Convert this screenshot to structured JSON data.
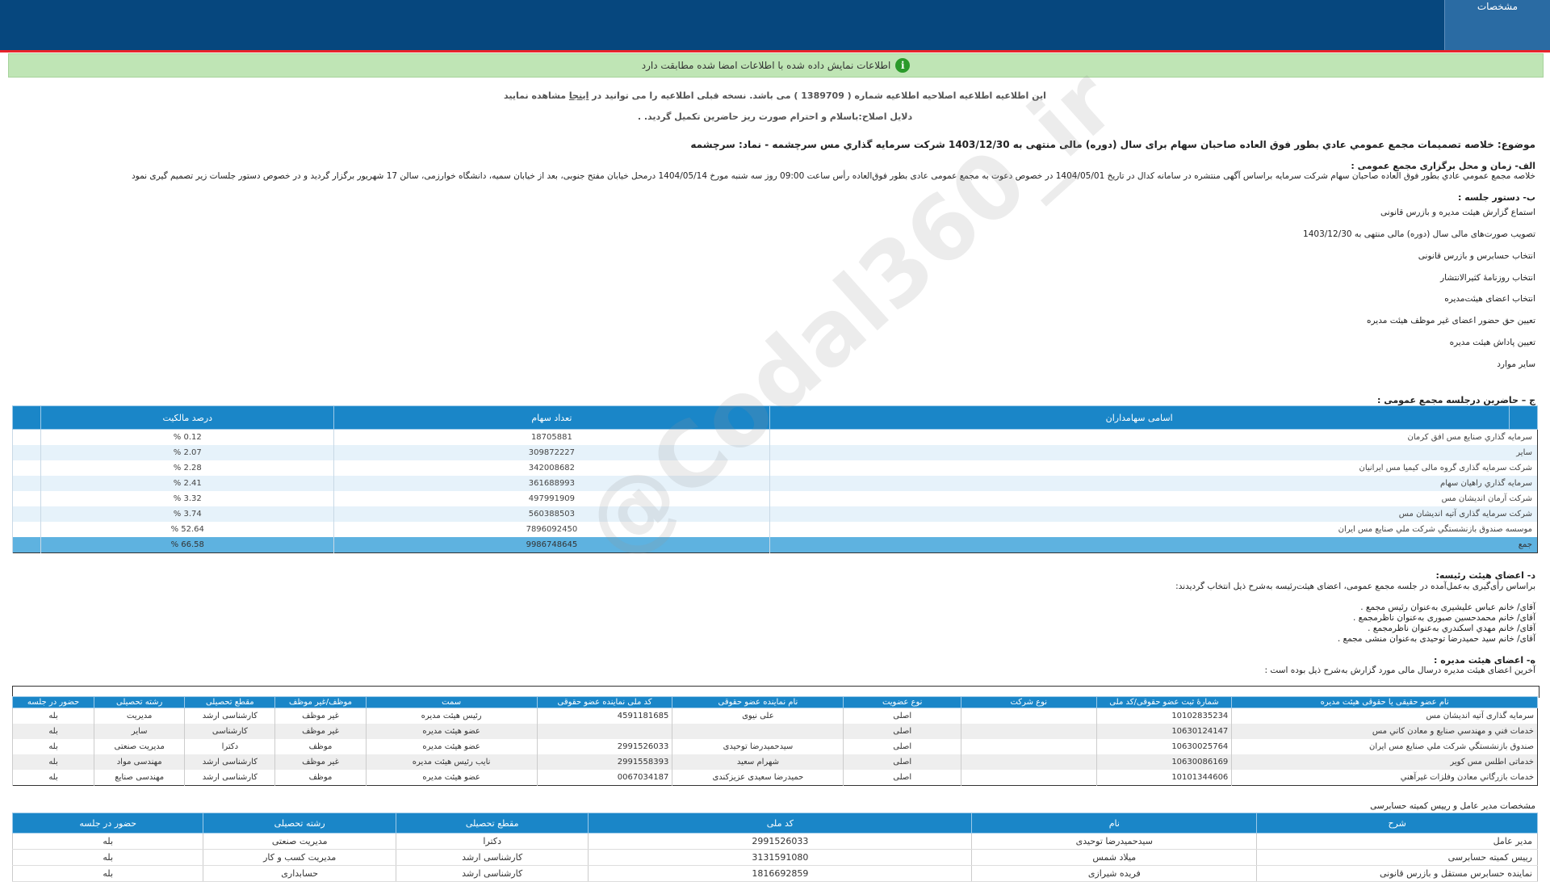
{
  "header": {
    "tab_label": "مشخصات"
  },
  "notice": {
    "text": "اطلاعات نمایش داده شده با اطلاعات امضا شده مطابقت دارد"
  },
  "correction": {
    "line1_prefix": "این اطلاعیه اطلاعیه اصلاحیه اطلاعیه شماره ( 1389709 ) می باشد. نسخه قبلی اطلاعیه را می توانید در ",
    "link": "اینجا",
    "line1_suffix": " مشاهده نمایید",
    "line2": "دلایل اصلاح:باسلام و احترام صورت ریز حاضرین تکمیل گردید. ."
  },
  "subject": "موضوع: خلاصه تصمیمات مجمع عمومي عادي بطور فوق العاده صاحبان سهام برای سال (دوره) مالی منتهی به 1403/12/30 شركت سرمايه گذاري مس سرچشمه - نماد: سرچشمه",
  "section_a": {
    "title": "الف- زمان و محل برگزاری مجمع عمومی :",
    "text": "خلاصه مجمع عمومي عادي بطور فوق العاده صاحبان سهام شرکت سرمایه براساس آگهی منتشره در سامانه کدال در تاریخ 1404/05/01 در خصوص دعوت به مجمع عمومی عادی بطور فوق‌العاده رأس ساعت 09:00 روز سه شنبه مورخ 1404/05/14 درمحل  خیابان مفتح جنوبی، بعد از خیابان سمیه، دانشگاه خوارزمی، سالن 17 شهریور   برگزار گردید و در خصوص دستور جلسات زیر تصمیم گیری نمود"
  },
  "section_b": {
    "title": "ب- دستور جلسه :",
    "items": [
      "استماع گزارش هیئت مدیره و بازرس قانونی",
      "تصویب صورت‌های مالی سال (دوره) مالی منتهی به 1403/12/30",
      "انتخاب حسابرس و بازرس قانونی",
      "انتخاب روزنامهٔ کثیرالانتشار",
      "انتخاب اعضای هیئت‌مدیره",
      "تعیین حق حضور اعضای غیر موظف هیئت مدیره",
      "تعیین پاداش هیئت مدیره",
      "سایر موارد"
    ]
  },
  "section_c": {
    "title": "ج – حاضرین درجلسه مجمع عمومی :",
    "headers": [
      "اسامی سهامداران",
      "تعداد سهام",
      "درصد مالکیت"
    ],
    "rows": [
      [
        "سرمايه گذاري صنايع مس افق كرمان",
        "18705881",
        "0.12 %"
      ],
      [
        "سایر",
        "309872227",
        "2.07 %"
      ],
      [
        "شرکت سرمایه گذاری گروه مالی کیمیا مس ایرانیان",
        "342008682",
        "2.28 %"
      ],
      [
        "سرمايه گذاري راهيان سهام",
        "361688993",
        "2.41 %"
      ],
      [
        "شرکت آرمان اندیشان مس",
        "497991909",
        "3.32 %"
      ],
      [
        "شرکت سرمایه گذاری آتیه اندیشان مس",
        "560388503",
        "3.74 %"
      ],
      [
        "موسسه صندوق بازنشستگي شركت ملي صنايع مس ايران",
        "7896092450",
        "52.64 %"
      ]
    ],
    "total": [
      "جمع",
      "9986748645",
      "66.58 %"
    ]
  },
  "section_d": {
    "title": "د- اعضای هیئت رئیسه:",
    "text": "براساس رأی‌گیری به‌عمل‌آمده در جلسه مجمع عمومی، اعضای هیئت‌رئیسه به‌شرح ذیل انتخاب گردیدند:",
    "members": [
      "آقای/ خانم  عباس علیشیری  به‌عنوان رئیس مجمع .",
      "آقای/ خانم  محمدحسین صبوری  به‌عنوان ناظرمجمع .",
      "آقای/ خانم  مهدي اسكندري  به‌عنوان ناظرمجمع .",
      "آقای/ خانم  سید حمیدرضا توحیدی  به‌عنوان منشی مجمع ."
    ]
  },
  "section_e": {
    "title": "ه- اعضای هیئت مدیره :",
    "text": "آخرین اعضای هیئت مدیره درسال مالی مورد گزارش به‌شرح ذیل بوده است :",
    "headers": [
      "نام عضو حقیقی یا حقوقی هیئت مدیره",
      "شمارهٔ ثبت عضو حقوقی/کد ملی",
      "نوع شرکت",
      "نوع عضویت",
      "نام نماینده عضو حقوقی",
      "کد ملی نماینده عضو حقوقی",
      "سمت",
      "موظف/غیر موظف",
      "مقطع تحصیلی",
      "رشته تحصیلی",
      "حضور در جلسه"
    ],
    "rows": [
      [
        "سرمایه گذاری آتیه اندیشان مس",
        "10102835234",
        "",
        "اصلی",
        "علی نیوی",
        "4591181685",
        "رئیس هیئت مدیره",
        "غیر موظف",
        "کارشناسی ارشد",
        "مدیریت",
        "بله"
      ],
      [
        "خدمات فني و مهندسي صنايع و معادن كاني مس",
        "10630124147",
        "",
        "اصلی",
        "",
        "",
        "عضو هیئت مدیره",
        "غیر موظف",
        "کارشناسی",
        "سایر",
        "بله"
      ],
      [
        "صندوق بازنشستگي شركت ملي صنايع مس ايران",
        "10630025764",
        "",
        "اصلی",
        "سیدحمیدرضا توحیدی",
        "2991526033",
        "عضو هیئت مدیره",
        "موظف",
        "دکترا",
        "مدیریت صنعتی",
        "بله"
      ],
      [
        "خدماتی اطلس مس کویر",
        "10630086169",
        "",
        "اصلی",
        "شهرام سعید",
        "2991558393",
        "نایب رئیس هیئت مدیره",
        "غیر موظف",
        "کارشناسی ارشد",
        "مهندسی مواد",
        "بله"
      ],
      [
        "خدمات بازرگاني معادن وفلزات غيرآهني",
        "10101344606",
        "",
        "اصلی",
        "حمیدرضا سعیدی عزیزکندی",
        "0067034187",
        "عضو هیئت مدیره",
        "موظف",
        "کارشناسی ارشد",
        "مهندسی صنایع",
        "بله"
      ]
    ]
  },
  "section_f": {
    "title": "مشخصات مدیر عامل و رییس کمیته حسابرسی",
    "headers": [
      "شرح",
      "نام",
      "کد ملی",
      "مقطع تحصیلی",
      "رشته تحصیلی",
      "حضور در جلسه"
    ],
    "rows": [
      [
        "مدیر عامل",
        "سیدحمیدرضا توحیدی",
        "2991526033",
        "دکترا",
        "مدیریت صنعتی",
        "بله"
      ],
      [
        "رییس کمیته حسابرسی",
        "میلاد شمس",
        "3131591080",
        "کارشناسی ارشد",
        "مدیریت کسب و کار",
        "بله"
      ],
      [
        "نماینده حسابرس مستقل و بازرس قانونی",
        "فریده شیرازی",
        "1816692859",
        "کارشناسی ارشد",
        "حسابداری",
        "بله"
      ]
    ]
  },
  "watermark": "@Codal360_ir"
}
